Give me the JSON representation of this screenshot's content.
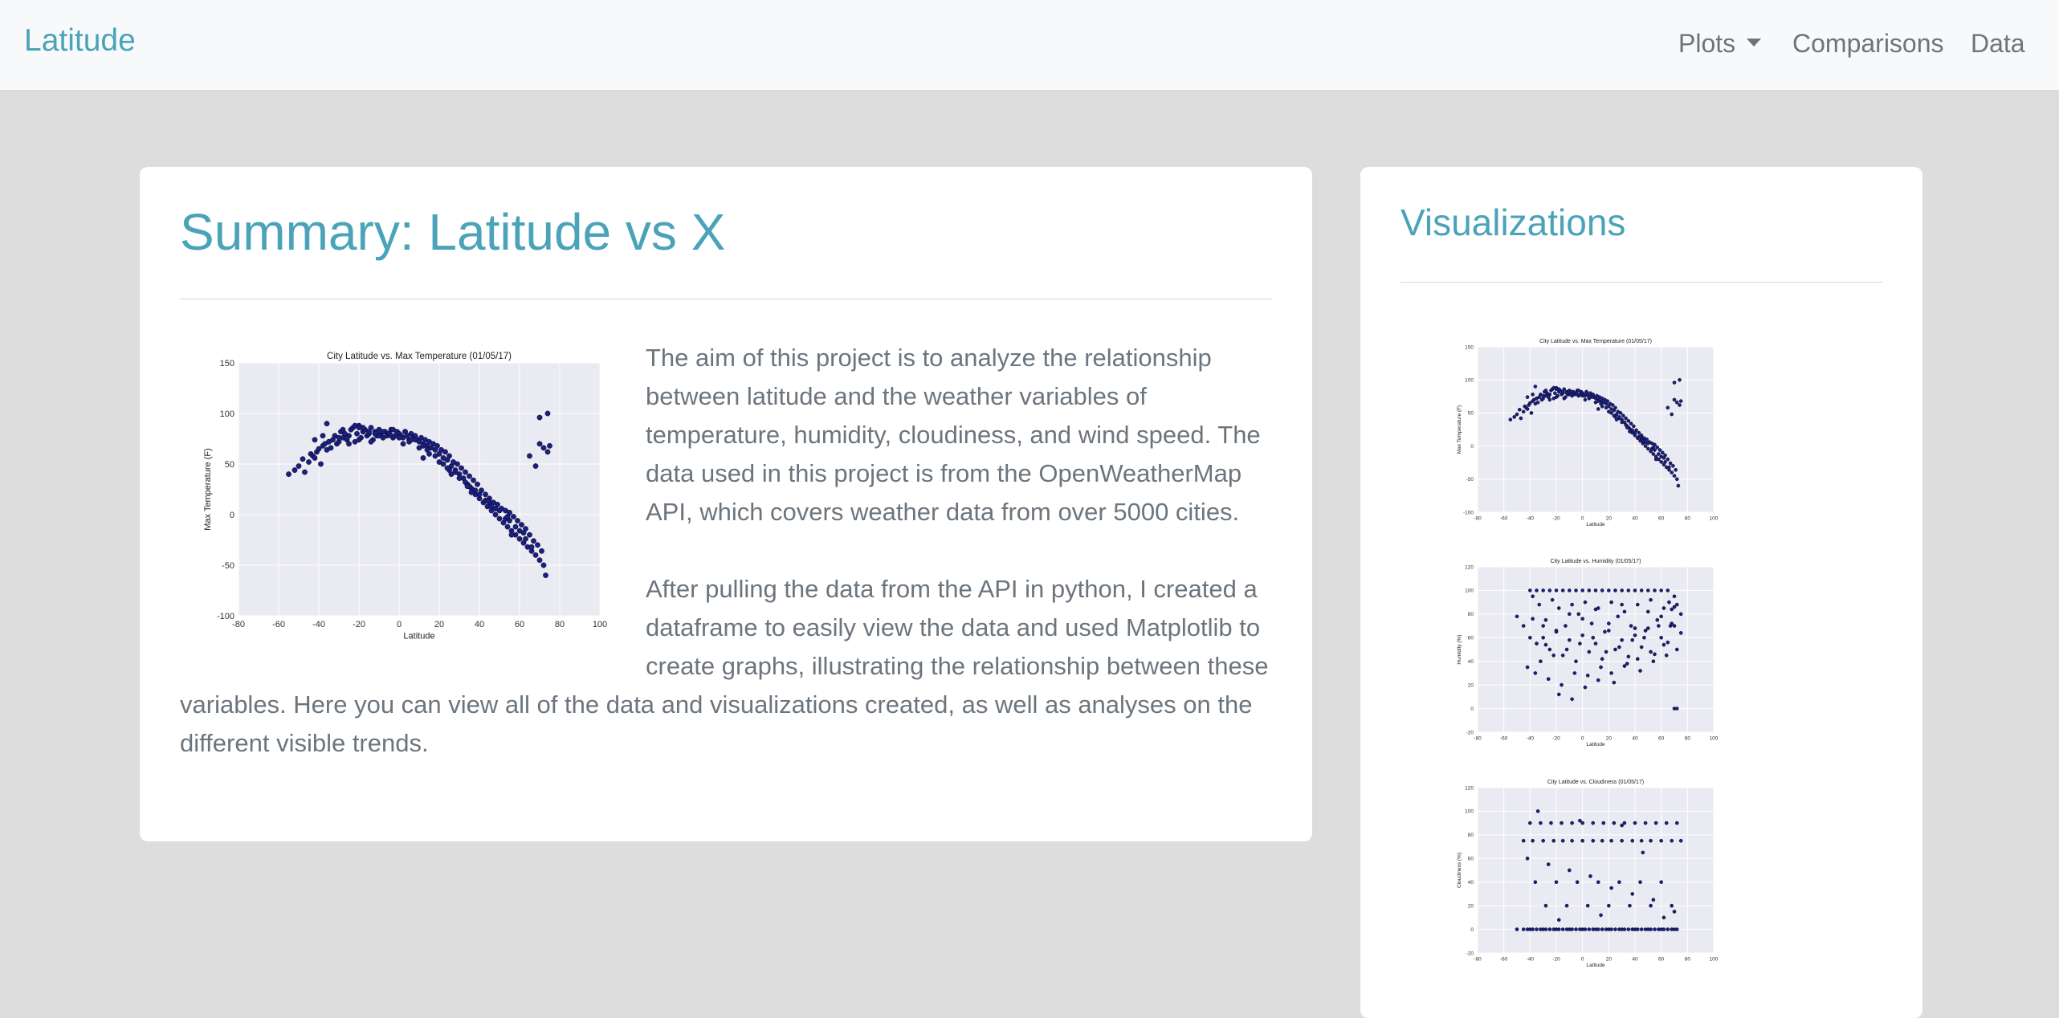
{
  "navbar": {
    "brand": "Latitude",
    "items": [
      {
        "label": "Plots",
        "dropdown": true
      },
      {
        "label": "Comparisons"
      },
      {
        "label": "Data"
      }
    ]
  },
  "summary": {
    "title": "Summary: Latitude vs X",
    "paragraph1": "The aim of this project is to analyze the relationship between latitude and the weather variables of temperature, humidity, cloudiness, and wind speed. The data used in this project is from the OpenWeatherMap API, which covers weather data from over 5000 cities.",
    "paragraph2": "After pulling the data from the API in python, I created a dataframe to easily view the data and used Matplotlib to create graphs, illustrating the relationship between these variables. Here you can view all of the data and visualizations created, as well as analyses on the different visible trends."
  },
  "visualizations": {
    "title": "Visualizations"
  },
  "colors": {
    "accent": "#4aa3b8",
    "text": "#6c757d",
    "background": "#dddddd",
    "point": "#1a1f80",
    "plot_bg": "#eaeaf2"
  },
  "chart_data": [
    {
      "id": "temp",
      "type": "scatter",
      "title": "City Latitude vs. Max Temperature (01/05/17)",
      "xlabel": "Latitude",
      "ylabel": "Max Temperature (F)",
      "xlim": [
        -80,
        100
      ],
      "ylim": [
        -100,
        150
      ],
      "xticks": [
        -80,
        -60,
        -40,
        -20,
        0,
        20,
        40,
        60,
        80,
        100
      ],
      "yticks": [
        -100,
        -50,
        0,
        50,
        100,
        150
      ],
      "grid": true,
      "x": [
        -55,
        -52,
        -50,
        -48,
        -47,
        -45,
        -44,
        -43,
        -42,
        -41,
        -40,
        -39,
        -38,
        -37,
        -36,
        -35,
        -34,
        -33,
        -32,
        -31,
        -30,
        -29,
        -28,
        -27,
        -26,
        -25,
        -24,
        -23,
        -22,
        -21,
        -20,
        -19,
        -18,
        -17,
        -16,
        -15,
        -14,
        -13,
        -12,
        -11,
        -10,
        -9,
        -8,
        -7,
        -6,
        -5,
        -4,
        -3,
        -2,
        -1,
        0,
        1,
        2,
        3,
        4,
        5,
        6,
        7,
        8,
        9,
        10,
        11,
        12,
        13,
        14,
        15,
        16,
        17,
        18,
        19,
        20,
        21,
        22,
        23,
        24,
        25,
        26,
        27,
        28,
        29,
        30,
        31,
        32,
        33,
        34,
        35,
        36,
        37,
        38,
        39,
        40,
        41,
        42,
        43,
        44,
        45,
        46,
        47,
        48,
        49,
        50,
        51,
        52,
        53,
        54,
        55,
        56,
        57,
        58,
        59,
        60,
        61,
        62,
        63,
        64,
        65,
        66,
        67,
        68,
        69,
        70,
        71,
        72,
        73,
        74,
        75,
        -35,
        -30,
        -25,
        -20,
        -15,
        -10,
        -5,
        0,
        5,
        10,
        15,
        20,
        25,
        30,
        35,
        40,
        45,
        50,
        55,
        60,
        65,
        70,
        -42,
        -38,
        -28,
        -22,
        -18,
        -12,
        -8,
        -3,
        3,
        8,
        12,
        18,
        22,
        28,
        33,
        38,
        43,
        48,
        53,
        58,
        63,
        68,
        72,
        -36,
        -26,
        -14,
        -4,
        6,
        14,
        24,
        34,
        44,
        54,
        62,
        66,
        70,
        74,
        -20,
        -10,
        2,
        12,
        26,
        36,
        46,
        56,
        64,
        68
      ],
      "y": [
        40,
        44,
        48,
        55,
        42,
        52,
        60,
        58,
        56,
        62,
        65,
        50,
        68,
        70,
        64,
        72,
        66,
        74,
        78,
        70,
        72,
        82,
        76,
        80,
        74,
        78,
        84,
        86,
        72,
        80,
        88,
        76,
        82,
        84,
        78,
        80,
        86,
        74,
        82,
        78,
        84,
        80,
        76,
        82,
        78,
        80,
        84,
        76,
        78,
        82,
        80,
        78,
        76,
        82,
        78,
        74,
        80,
        76,
        78,
        74,
        72,
        76,
        70,
        74,
        68,
        72,
        66,
        70,
        64,
        68,
        60,
        64,
        56,
        62,
        54,
        58,
        48,
        52,
        44,
        50,
        40,
        46,
        36,
        42,
        30,
        38,
        26,
        34,
        20,
        30,
        16,
        24,
        12,
        20,
        8,
        16,
        4,
        12,
        0,
        10,
        -4,
        6,
        -8,
        4,
        -12,
        2,
        -16,
        -2,
        -20,
        -6,
        -24,
        -10,
        -28,
        -14,
        -32,
        -20,
        -36,
        -26,
        -40,
        -30,
        -45,
        -36,
        -50,
        -60,
        62,
        68,
        72,
        76,
        70,
        74,
        82,
        78,
        80,
        76,
        72,
        66,
        60,
        52,
        44,
        36,
        28,
        20,
        12,
        4,
        -6,
        -16,
        58,
        70,
        74,
        78,
        84,
        88,
        86,
        80,
        82,
        84,
        82,
        74,
        68,
        58,
        50,
        42,
        32,
        24,
        14,
        6,
        -4,
        -12,
        -24,
        48,
        66,
        90,
        76,
        72,
        78,
        74,
        64,
        46,
        28,
        14,
        -2,
        -18,
        -32,
        96,
        100,
        86,
        82,
        70,
        56,
        40,
        22,
        8,
        -20
      ]
    },
    {
      "id": "humidity",
      "type": "scatter",
      "title": "City Latitude vs. Humidity (01/05/17)",
      "xlabel": "Latitude",
      "ylabel": "Humidity (%)",
      "xlim": [
        -80,
        100
      ],
      "ylim": [
        -20,
        120
      ],
      "xticks": [
        -80,
        -60,
        -40,
        -20,
        0,
        20,
        40,
        60,
        80,
        100
      ],
      "yticks": [
        -20,
        0,
        20,
        40,
        60,
        80,
        100,
        120
      ],
      "grid": true,
      "x": [
        -50,
        -45,
        -40,
        -38,
        -35,
        -33,
        -30,
        -28,
        -25,
        -23,
        -20,
        -18,
        -15,
        -13,
        -10,
        -8,
        -5,
        -3,
        0,
        2,
        5,
        7,
        10,
        12,
        15,
        17,
        20,
        22,
        25,
        27,
        30,
        32,
        35,
        37,
        40,
        42,
        45,
        47,
        50,
        52,
        55,
        57,
        60,
        62,
        65,
        67,
        70,
        72,
        75,
        -40,
        -35,
        -30,
        -25,
        -20,
        -15,
        -10,
        -5,
        0,
        5,
        10,
        15,
        20,
        25,
        30,
        35,
        40,
        45,
        50,
        55,
        60,
        65,
        70,
        75,
        -42,
        -36,
        -32,
        -26,
        -22,
        -16,
        -12,
        -6,
        -2,
        4,
        8,
        14,
        18,
        24,
        28,
        34,
        38,
        44,
        48,
        54,
        58,
        64,
        68,
        72,
        -38,
        -28,
        -18,
        -8,
        2,
        12,
        22,
        32,
        42,
        52,
        62,
        -30,
        -20,
        -10,
        0,
        10,
        20,
        30,
        40,
        50,
        60,
        70,
        66,
        68,
        70,
        72
      ],
      "y": [
        78,
        70,
        100,
        95,
        100,
        88,
        100,
        75,
        100,
        92,
        100,
        85,
        100,
        70,
        100,
        88,
        100,
        80,
        100,
        90,
        100,
        72,
        100,
        85,
        100,
        65,
        100,
        90,
        100,
        78,
        100,
        82,
        100,
        70,
        100,
        88,
        100,
        60,
        100,
        92,
        100,
        75,
        100,
        85,
        100,
        70,
        95,
        88,
        80,
        60,
        55,
        70,
        50,
        65,
        45,
        58,
        40,
        62,
        48,
        55,
        42,
        66,
        50,
        58,
        44,
        62,
        52,
        68,
        46,
        60,
        56,
        70,
        64,
        35,
        30,
        40,
        25,
        45,
        20,
        50,
        30,
        55,
        28,
        60,
        35,
        48,
        22,
        52,
        38,
        58,
        32,
        66,
        40,
        70,
        45,
        72,
        50,
        76,
        54,
        12,
        8,
        18,
        24,
        30,
        36,
        42,
        48,
        54,
        60,
        66,
        80,
        76,
        84,
        72,
        88,
        68,
        82,
        78,
        86,
        90,
        84,
        0,
        0,
        0,
        0
      ]
    },
    {
      "id": "cloudiness",
      "type": "scatter",
      "title": "City Latitude vs. Cloudiness (01/05/17)",
      "xlabel": "Latitude",
      "ylabel": "Cloudiness (%)",
      "xlim": [
        -80,
        100
      ],
      "ylim": [
        -20,
        120
      ],
      "xticks": [
        -80,
        -60,
        -40,
        -20,
        0,
        20,
        40,
        60,
        80,
        100
      ],
      "yticks": [
        -20,
        0,
        20,
        40,
        60,
        80,
        100,
        120
      ],
      "grid": true,
      "x": [
        -50,
        -45,
        -42,
        -40,
        -38,
        -35,
        -32,
        -30,
        -28,
        -25,
        -22,
        -20,
        -18,
        -15,
        -12,
        -10,
        -8,
        -5,
        -2,
        0,
        2,
        5,
        8,
        10,
        12,
        15,
        18,
        20,
        22,
        25,
        28,
        30,
        32,
        35,
        38,
        40,
        42,
        45,
        48,
        50,
        52,
        55,
        58,
        60,
        62,
        65,
        68,
        70,
        72,
        -45,
        -38,
        -30,
        -22,
        -15,
        -8,
        0,
        8,
        15,
        22,
        30,
        38,
        45,
        52,
        60,
        68,
        75,
        -40,
        -32,
        -24,
        -16,
        -8,
        0,
        8,
        16,
        24,
        32,
        40,
        48,
        56,
        64,
        72,
        -36,
        -28,
        -20,
        -12,
        -4,
        4,
        12,
        20,
        28,
        36,
        44,
        52,
        60,
        68,
        -42,
        -26,
        -10,
        6,
        22,
        38,
        54,
        70,
        -34,
        -18,
        -2,
        14,
        30,
        46,
        62
      ],
      "y": [
        0,
        0,
        0,
        0,
        0,
        0,
        0,
        0,
        0,
        0,
        0,
        0,
        0,
        0,
        0,
        0,
        0,
        0,
        0,
        0,
        0,
        0,
        0,
        0,
        0,
        0,
        0,
        0,
        0,
        0,
        0,
        0,
        0,
        0,
        0,
        0,
        0,
        0,
        0,
        0,
        0,
        0,
        0,
        0,
        0,
        0,
        0,
        0,
        0,
        75,
        75,
        75,
        75,
        75,
        75,
        75,
        75,
        75,
        75,
        75,
        75,
        75,
        75,
        75,
        75,
        75,
        90,
        90,
        90,
        90,
        90,
        90,
        90,
        90,
        90,
        90,
        90,
        90,
        90,
        90,
        90,
        40,
        20,
        40,
        20,
        40,
        20,
        40,
        20,
        40,
        20,
        40,
        20,
        40,
        20,
        60,
        55,
        50,
        45,
        35,
        30,
        25,
        15,
        100,
        8,
        92,
        12,
        88,
        65,
        10
      ]
    }
  ]
}
